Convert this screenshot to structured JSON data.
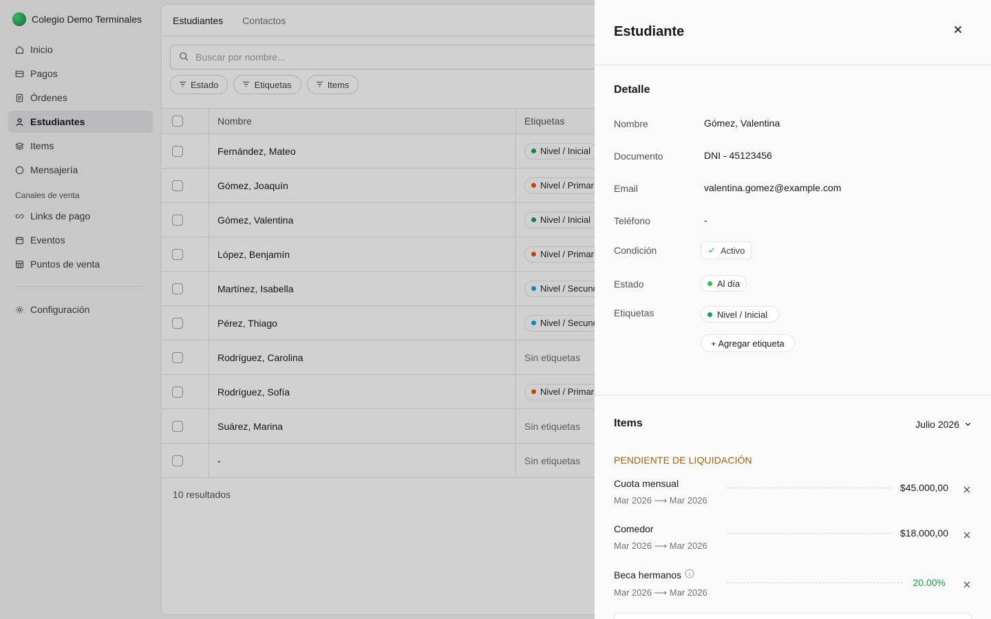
{
  "sidebar": {
    "brand": "Colegio Demo Terminales",
    "items": [
      {
        "label": "Inicio",
        "icon": "home-icon"
      },
      {
        "label": "Pagos",
        "icon": "credit-card-icon"
      },
      {
        "label": "Órdenes",
        "icon": "receipt-icon"
      },
      {
        "label": "Estudiantes",
        "icon": "user-icon",
        "active": true
      },
      {
        "label": "Items",
        "icon": "layers-icon"
      },
      {
        "label": "Mensajería",
        "icon": "message-icon"
      }
    ],
    "section_label": "Canales de venta",
    "channels": [
      {
        "label": "Links de pago",
        "icon": "link-icon"
      },
      {
        "label": "Eventos",
        "icon": "calendar-icon"
      },
      {
        "label": "Puntos de venta",
        "icon": "store-icon"
      }
    ],
    "settings": {
      "label": "Configuración",
      "icon": "gear-icon"
    }
  },
  "main": {
    "tabs": [
      "Estudiantes",
      "Contactos"
    ],
    "search_placeholder": "Buscar por nombre...",
    "filters": [
      "Estado",
      "Etiquetas",
      "Items"
    ],
    "columns": {
      "name": "Nombre",
      "tags": "Etiquetas"
    },
    "rows": [
      {
        "name": "Fernández, Mateo",
        "tag": "Nivel / Inicial",
        "color": "#16a34a"
      },
      {
        "name": "Gómez, Joaquín",
        "tag": "Nivel / Primaria",
        "color": "#ea580c"
      },
      {
        "name": "Gómez, Valentina",
        "tag": "Nivel / Inicial",
        "color": "#16a34a"
      },
      {
        "name": "López, Benjamín",
        "tag": "Nivel / Primaria",
        "color": "#ea580c"
      },
      {
        "name": "Martínez, Isabella",
        "tag": "Nivel / Secundaria",
        "color": "#0ea5e9"
      },
      {
        "name": "Pérez, Thiago",
        "tag": "Nivel / Secundaria",
        "color": "#0ea5e9"
      },
      {
        "name": "Rodríguez, Carolina",
        "tag": "",
        "empty": "Sin etiquetas"
      },
      {
        "name": "Rodríguez, Sofía",
        "tag": "Nivel / Primaria",
        "color": "#ea580c"
      },
      {
        "name": "Suárez, Marina",
        "tag": "",
        "empty": "Sin etiquetas"
      },
      {
        "name": "-",
        "tag": "",
        "empty": "Sin etiquetas"
      }
    ],
    "results": "10 resultados"
  },
  "drawer": {
    "title": "Estudiante",
    "detail_title": "Detalle",
    "fields": {
      "nombre_label": "Nombre",
      "nombre": "Gómez, Valentina",
      "documento_label": "Documento",
      "documento": "DNI - 45123456",
      "email_label": "Email",
      "email": "valentina.gomez@example.com",
      "telefono_label": "Teléfono",
      "telefono": "-",
      "condicion_label": "Condición",
      "condicion": "Activo",
      "estado_label": "Estado",
      "estado": "Al día",
      "etiquetas_label": "Etiquetas",
      "etiqueta": "Nivel / Inicial",
      "add_tag": "+ Agregar etiqueta"
    },
    "items_title": "Items",
    "period": "Julio 2026",
    "pending_label": "PENDIENTE DE LIQUIDACIÓN",
    "items": [
      {
        "name": "Cuota mensual",
        "range": "Mar 2026 ⟶ Mar 2026",
        "amount": "$45.000,00"
      },
      {
        "name": "Comedor",
        "range": "Mar 2026 ⟶ Mar 2026",
        "amount": "$18.000,00"
      },
      {
        "name": "Beca hermanos",
        "range": "Mar 2026 ⟶ Mar 2026",
        "amount": "20.00%"
      }
    ],
    "colors": {
      "accent_green": "#16a34a",
      "pending": "#a16207",
      "estado_dot": "#22c55e"
    }
  }
}
